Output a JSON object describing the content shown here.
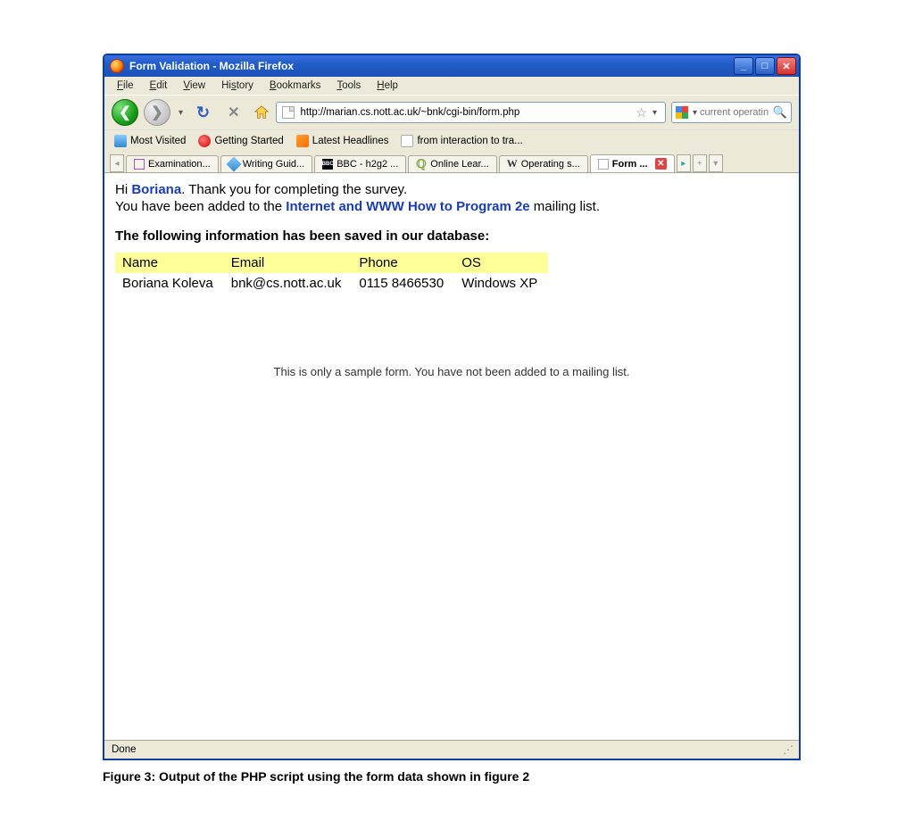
{
  "window": {
    "title": "Form Validation - Mozilla Firefox"
  },
  "menu": {
    "items": [
      "File",
      "Edit",
      "View",
      "History",
      "Bookmarks",
      "Tools",
      "Help"
    ]
  },
  "address": {
    "url": "http://marian.cs.nott.ac.uk/~bnk/cgi-bin/form.php"
  },
  "search": {
    "placeholder": "current operatin"
  },
  "bookmarks": {
    "items": [
      {
        "label": "Most Visited"
      },
      {
        "label": "Getting Started"
      },
      {
        "label": "Latest Headlines"
      },
      {
        "label": "from interaction to tra..."
      }
    ]
  },
  "tabs": {
    "items": [
      {
        "label": "Examination..."
      },
      {
        "label": "Writing Guid..."
      },
      {
        "label": "BBC - h2g2 ..."
      },
      {
        "label": "Online Lear..."
      },
      {
        "label": "Operating s..."
      },
      {
        "label": "Form ..."
      }
    ]
  },
  "page": {
    "hi": "Hi",
    "name": "Boriana",
    "thanks": ". Thank you for completing the survey.",
    "added_pre": "You have been added to the ",
    "book": "Internet and WWW How to Program 2e",
    "added_post": " mailing list.",
    "heading": "The following information has been saved in our database:",
    "cols": {
      "name": "Name",
      "email": "Email",
      "phone": "Phone",
      "os": "OS"
    },
    "row": {
      "name": "Boriana Koleva",
      "email": "bnk@cs.nott.ac.uk",
      "phone": "0115 8466530",
      "os": "Windows XP"
    },
    "disclaimer": "This is only a sample form. You have not been added to a mailing list."
  },
  "status": {
    "text": "Done"
  },
  "caption": "Figure 3: Output of the PHP script using the form data shown in figure 2"
}
